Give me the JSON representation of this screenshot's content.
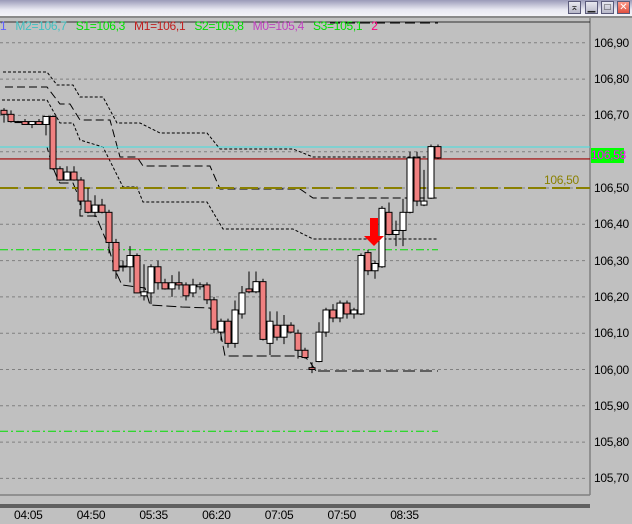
{
  "window": {
    "buttons": [
      "restore-down",
      "minimize",
      "maximize",
      "close"
    ]
  },
  "legend": [
    {
      "text": "1",
      "color": "#6060ff"
    },
    {
      "text": "M2=106,7",
      "color": "#40c0c0"
    },
    {
      "text": "S1=106,3",
      "color": "#00e000"
    },
    {
      "text": "M1=106,1",
      "color": "#c02020"
    },
    {
      "text": "S2=105,8",
      "color": "#00e000"
    },
    {
      "text": "M0=105,4",
      "color": "#c040c0"
    },
    {
      "text": "S3=105,1",
      "color": "#00e000"
    },
    {
      "text": "2",
      "color": "#ff0080"
    }
  ],
  "current_price": "106,58",
  "level_label": "106,50",
  "colors": {
    "bear": "#f08080",
    "bull": "#ffffff",
    "grid": "#808080",
    "price_line": "#a00000",
    "pivot_line": "#40e0e0",
    "level_line": "#8a8000",
    "support_line": "#00e000",
    "arrow": "#ff0000",
    "price_box": "#00ff00"
  },
  "chart_data": {
    "type": "candlestick",
    "ylim": [
      105.66,
      106.96
    ],
    "y_ticks": [
      "106,90",
      "106,80",
      "106,70",
      "106,60",
      "106,50",
      "106,40",
      "106,30",
      "106,20",
      "106,10",
      "106,00",
      "105,90",
      "105,80",
      "105,70"
    ],
    "y_tick_values": [
      106.9,
      106.8,
      106.7,
      106.6,
      106.5,
      106.4,
      106.3,
      106.2,
      106.1,
      106.0,
      105.9,
      105.8,
      105.7
    ],
    "x_ticks": [
      "04:05",
      "04:50",
      "05:35",
      "06:20",
      "07:05",
      "07:50",
      "08:35"
    ],
    "bar_interval_minutes": 5,
    "ohlc": [
      [
        106.714,
        106.72,
        106.68,
        106.703
      ],
      [
        106.703,
        106.714,
        106.68,
        106.683
      ],
      [
        106.683,
        106.685,
        106.68,
        106.683
      ],
      [
        106.683,
        106.69,
        106.675,
        106.675
      ],
      [
        106.675,
        106.683,
        106.665,
        106.683
      ],
      [
        106.683,
        106.69,
        106.675,
        106.675
      ],
      [
        106.675,
        106.697,
        106.645,
        106.697
      ],
      [
        106.697,
        106.7,
        106.55,
        106.553
      ],
      [
        106.553,
        106.56,
        106.52,
        106.522
      ],
      [
        106.522,
        106.56,
        106.52,
        106.544
      ],
      [
        106.544,
        106.56,
        106.52,
        106.522
      ],
      [
        106.522,
        106.53,
        106.44,
        106.464
      ],
      [
        106.464,
        106.5,
        106.43,
        106.433
      ],
      [
        106.433,
        106.48,
        106.42,
        106.453
      ],
      [
        106.453,
        106.47,
        106.43,
        106.433
      ],
      [
        106.433,
        106.44,
        106.32,
        106.35
      ],
      [
        106.35,
        106.36,
        106.25,
        106.272
      ],
      [
        106.283,
        106.3,
        106.27,
        106.285
      ],
      [
        106.283,
        106.34,
        106.24,
        106.314
      ],
      [
        106.314,
        106.32,
        106.21,
        106.211
      ],
      [
        106.203,
        106.29,
        106.19,
        106.214
      ],
      [
        106.211,
        106.29,
        106.18,
        106.283
      ],
      [
        106.283,
        106.3,
        106.22,
        106.239
      ],
      [
        106.239,
        106.25,
        106.22,
        106.222
      ],
      [
        106.222,
        106.26,
        106.2,
        106.239
      ],
      [
        106.239,
        106.27,
        106.22,
        106.233
      ],
      [
        106.233,
        106.24,
        106.19,
        106.203
      ],
      [
        106.211,
        106.25,
        106.2,
        106.233
      ],
      [
        106.228,
        106.24,
        106.22,
        106.233
      ],
      [
        106.233,
        106.24,
        106.18,
        106.192
      ],
      [
        106.192,
        106.2,
        106.1,
        106.111
      ],
      [
        106.103,
        106.14,
        106.08,
        106.133
      ],
      [
        106.133,
        106.14,
        106.06,
        106.072
      ],
      [
        106.072,
        106.19,
        106.06,
        106.164
      ],
      [
        106.153,
        106.23,
        106.14,
        106.211
      ],
      [
        106.222,
        106.27,
        106.21,
        106.214
      ],
      [
        106.214,
        106.27,
        106.21,
        106.242
      ],
      [
        106.242,
        106.25,
        106.08,
        106.083
      ],
      [
        106.072,
        106.16,
        106.04,
        106.133
      ],
      [
        106.122,
        106.16,
        106.08,
        106.089
      ],
      [
        106.089,
        106.15,
        106.07,
        106.122
      ],
      [
        106.122,
        106.13,
        106.1,
        106.103
      ],
      [
        106.1,
        106.11,
        106.03,
        106.053
      ],
      [
        106.053,
        106.06,
        106.03,
        106.033
      ],
      [
        106.005,
        106.02,
        105.99,
        106.0
      ],
      [
        106.022,
        106.13,
        106.02,
        106.103
      ],
      [
        106.103,
        106.17,
        106.09,
        106.164
      ],
      [
        106.164,
        106.18,
        106.13,
        106.142
      ],
      [
        106.142,
        106.19,
        106.13,
        106.183
      ],
      [
        106.183,
        106.19,
        106.14,
        106.153
      ],
      [
        106.153,
        106.17,
        106.14,
        106.164
      ],
      [
        106.153,
        106.32,
        106.15,
        106.314
      ],
      [
        106.322,
        106.33,
        106.26,
        106.272
      ],
      [
        106.272,
        106.3,
        106.25,
        106.292
      ],
      [
        106.283,
        106.45,
        106.28,
        106.444
      ],
      [
        106.433,
        106.46,
        106.37,
        106.372
      ],
      [
        106.372,
        106.41,
        106.34,
        106.383
      ],
      [
        106.383,
        106.47,
        106.34,
        106.433
      ],
      [
        106.433,
        106.6,
        106.43,
        106.583
      ],
      [
        106.583,
        106.6,
        106.45,
        106.464
      ],
      [
        106.453,
        106.55,
        106.45,
        106.464
      ],
      [
        106.472,
        106.62,
        106.47,
        106.614
      ],
      [
        106.614,
        106.62,
        106.58,
        106.583
      ]
    ],
    "horizontal_lines": {
      "current_price": 106.58,
      "pivot": 106.613,
      "level": 106.5,
      "support": 106.33,
      "lower_support": 105.83
    },
    "signal": {
      "type": "down-arrow",
      "bar_index": 52
    }
  }
}
